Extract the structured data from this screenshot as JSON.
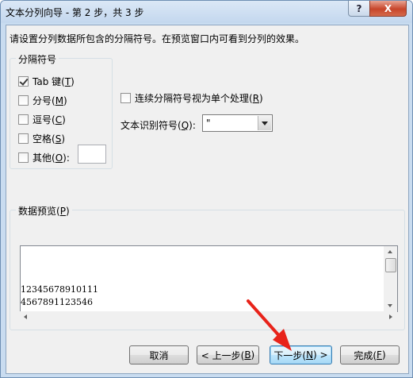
{
  "window": {
    "title": "文本分列向导 - 第 2 步，共 3 步",
    "help_label": "?",
    "close_label": "X"
  },
  "description": "请设置分列数据所包含的分隔符号。在预览窗口内可看到分列的效果。",
  "delimiters": {
    "group_label": "分隔符号",
    "tab": {
      "label": "Tab 键(",
      "key": "T",
      "end": ")",
      "checked": true
    },
    "semicolon": {
      "label": "分号(",
      "key": "M",
      "end": ")",
      "checked": false
    },
    "comma": {
      "label": "逗号(",
      "key": "C",
      "end": ")",
      "checked": false
    },
    "space": {
      "label": "空格(",
      "key": "S",
      "end": ")",
      "checked": false
    },
    "other": {
      "label": "其他(",
      "key": "O",
      "end": "):",
      "checked": false,
      "value": ""
    }
  },
  "consecutive": {
    "label": "连续分隔符号视为单个处理(",
    "key": "R",
    "end": ")",
    "checked": false
  },
  "text_qualifier": {
    "label": "文本识别符号(",
    "key": "Q",
    "end": "):",
    "value": "\""
  },
  "preview": {
    "label": "数据预览(",
    "key": "P",
    "end": ")",
    "lines": [
      "12345678910111",
      "4567891123546"
    ]
  },
  "buttons": {
    "cancel": "取消",
    "back": {
      "label": "< 上一步(",
      "key": "B",
      "end": ")"
    },
    "next": {
      "label": "下一步(",
      "key": "N",
      "end": ") >"
    },
    "finish": {
      "label": "完成(",
      "key": "F",
      "end": ")"
    }
  }
}
